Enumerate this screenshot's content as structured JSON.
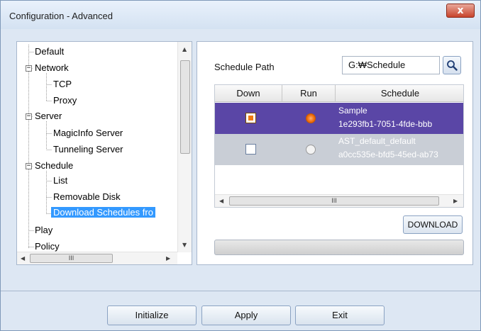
{
  "window": {
    "title": "Configuration - Advanced",
    "close_label": "x"
  },
  "tree": {
    "items": [
      {
        "label": "Default"
      },
      {
        "label": "Network",
        "expander": "−"
      },
      {
        "label": "TCP"
      },
      {
        "label": "Proxy"
      },
      {
        "label": "Server",
        "expander": "−"
      },
      {
        "label": "MagicInfo Server"
      },
      {
        "label": "Tunneling Server"
      },
      {
        "label": "Schedule",
        "expander": "−"
      },
      {
        "label": "List"
      },
      {
        "label": "Removable Disk"
      },
      {
        "label": "Download Schedules fro"
      },
      {
        "label": "Play"
      },
      {
        "label": "Policy"
      }
    ],
    "selected": "Download Schedules fro",
    "hscroll_grip": "III"
  },
  "schedule_path": {
    "label": "Schedule Path",
    "value": "G:₩Schedule"
  },
  "table": {
    "headers": [
      "Down",
      "Run",
      "Schedule"
    ],
    "rows": [
      {
        "name_line1": "Sample",
        "name_line2": "1e293fb1-7051-4fde-bbb",
        "down_checked": true,
        "run_selected": true
      },
      {
        "name_line1": "AST_default_default",
        "name_line2": "a0cc535e-bfd5-45ed-ab73",
        "down_checked": false,
        "run_selected": false
      }
    ],
    "hscroll_grip": "III"
  },
  "download_label": "DOWNLOAD",
  "progress": {
    "value": 0
  },
  "buttons": {
    "initialize": "Initialize",
    "apply": "Apply",
    "exit": "Exit"
  }
}
